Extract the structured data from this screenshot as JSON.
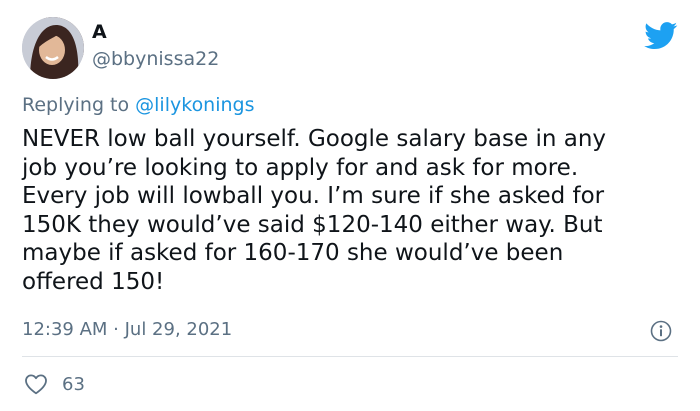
{
  "author": {
    "display_name": "A",
    "handle": "@bbynissa22"
  },
  "reply": {
    "prefix": "Replying to ",
    "mention": "@lilykonings"
  },
  "tweet": {
    "lines": [
      "NEVER low ball yourself. Google salary base in any",
      "job you’re looking to apply for and ask for more.",
      "Every job will lowball you. I’m sure if she asked for",
      "150K they would’ve said $120-140 either way. But",
      "maybe if asked for 160-170 she would’ve been",
      "offered 150!"
    ],
    "timestamp": "12:39 AM · Jul 29, 2021"
  },
  "actions": {
    "like_count": "63"
  },
  "icons": {
    "brand": "twitter-bird-icon",
    "info": "info-icon",
    "like": "heart-icon"
  },
  "colors": {
    "brand_blue": "#1da1f2",
    "link_blue": "#1b95e0",
    "secondary_text": "#5b7083",
    "divider": "#dfe3e7"
  }
}
